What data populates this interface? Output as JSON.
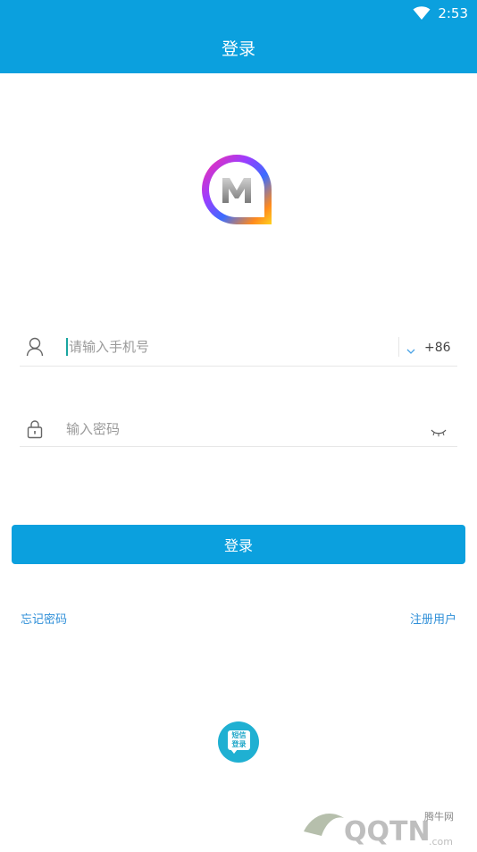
{
  "status_bar": {
    "time": "2:53"
  },
  "header": {
    "title": "登录"
  },
  "login_form": {
    "phone": {
      "placeholder": "请输入手机号",
      "country_code": "+86"
    },
    "password": {
      "placeholder": "输入密码"
    },
    "submit_label": "登录"
  },
  "links": {
    "forgot_password": "忘记密码",
    "register": "注册用户"
  },
  "sms_login": {
    "label_line1": "短信",
    "label_line2": "登录"
  },
  "watermark": {
    "text": "腾牛网"
  },
  "colors": {
    "primary": "#0ba0de",
    "link": "#2f8fd8",
    "sms": "#1fb0d2"
  },
  "icons": {
    "user": "user-icon",
    "lock": "lock-icon",
    "eye": "eye-closed-icon",
    "chevron": "chevron-down-icon",
    "wifi": "wifi-icon"
  }
}
